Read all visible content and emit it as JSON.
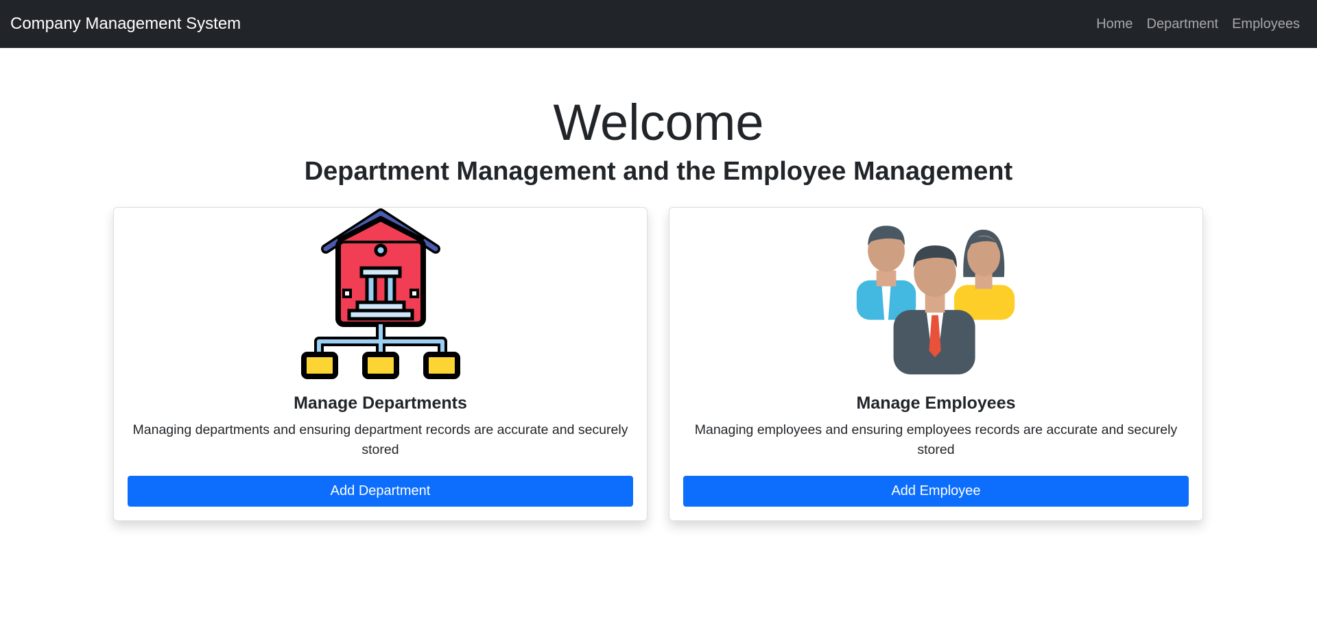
{
  "navbar": {
    "brand": "Company Management System",
    "links": [
      "Home",
      "Department",
      "Employees"
    ]
  },
  "hero": {
    "title": "Welcome",
    "subtitle": "Department Management and the Employee Management"
  },
  "cards": [
    {
      "icon": "department-building-icon",
      "title": "Manage Departments",
      "text": "Managing departments and ensuring department records are accurate and securely stored",
      "button": "Add Department"
    },
    {
      "icon": "employees-group-icon",
      "title": "Manage Employees",
      "text": "Managing employees and ensuring employees records are accurate and securely stored",
      "button": "Add Employee"
    }
  ],
  "colors": {
    "navbar_bg": "#212529",
    "primary_button": "#0d6efd"
  }
}
